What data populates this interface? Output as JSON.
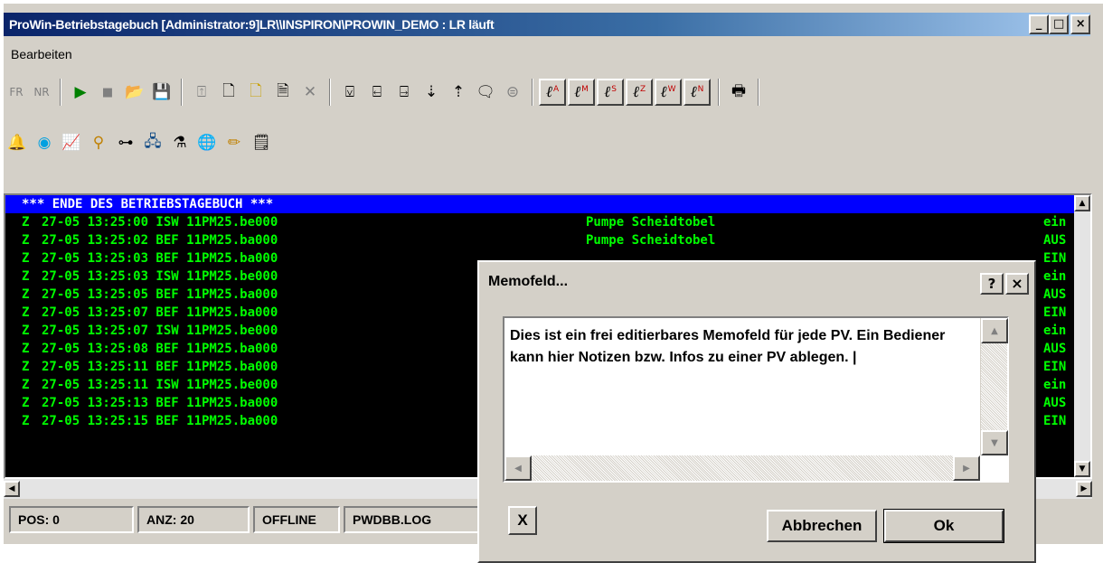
{
  "window": {
    "title": "ProWin-Betriebstagebuch [Administrator:9]LR\\\\INSPIRON\\PROWIN_DEMO : LR läuft",
    "controls": [
      "_",
      "□",
      "×"
    ]
  },
  "menu": {
    "items": [
      "Bearbeiten"
    ]
  },
  "toolbar1": {
    "fr": "FR",
    "nr": "NR",
    "pens": [
      {
        "sub": "A"
      },
      {
        "sub": "M"
      },
      {
        "sub": "S"
      },
      {
        "sub": "Z"
      },
      {
        "sub": "W"
      },
      {
        "sub": "N"
      }
    ],
    "pen_glyph": "ℓ"
  },
  "log": {
    "header": "*** ENDE DES BETRIEBSTAGEBUCH ***",
    "rows": [
      {
        "flag": "Z",
        "entry": "27-05 13:25:00 ISW 11PM25.be000",
        "name": "Pumpe Scheidtobel",
        "state": "ein"
      },
      {
        "flag": "Z",
        "entry": "27-05 13:25:02 BEF 11PM25.ba000",
        "name": "Pumpe Scheidtobel",
        "state": "AUS"
      },
      {
        "flag": "Z",
        "entry": "27-05 13:25:03 BEF 11PM25.ba000",
        "name": "",
        "state": "EIN"
      },
      {
        "flag": "Z",
        "entry": "27-05 13:25:03 ISW 11PM25.be000",
        "name": "",
        "state": "ein"
      },
      {
        "flag": "Z",
        "entry": "27-05 13:25:05 BEF 11PM25.ba000",
        "name": "",
        "state": "AUS"
      },
      {
        "flag": "Z",
        "entry": "27-05 13:25:07 BEF 11PM25.ba000",
        "name": "",
        "state": "EIN"
      },
      {
        "flag": "Z",
        "entry": "27-05 13:25:07 ISW 11PM25.be000",
        "name": "",
        "state": "ein"
      },
      {
        "flag": "Z",
        "entry": "27-05 13:25:08 BEF 11PM25.ba000",
        "name": "",
        "state": "AUS"
      },
      {
        "flag": "Z",
        "entry": "27-05 13:25:11 BEF 11PM25.ba000",
        "name": "",
        "state": "EIN"
      },
      {
        "flag": "Z",
        "entry": "27-05 13:25:11 ISW 11PM25.be000",
        "name": "",
        "state": "ein"
      },
      {
        "flag": "Z",
        "entry": "27-05 13:25:13 BEF 11PM25.ba000",
        "name": "",
        "state": "AUS"
      },
      {
        "flag": "Z",
        "entry": "27-05 13:25:15 BEF 11PM25.ba000",
        "name": "",
        "state": "EIN"
      }
    ]
  },
  "status": {
    "pos": "POS: 0",
    "anz": "ANZ: 20",
    "mode": "OFFLINE",
    "file": "PWDBB.LOG"
  },
  "dialog": {
    "title": "Memofeld...",
    "help": "?",
    "close": "×",
    "memo_text": "Dies ist ein frei editierbares Memofeld für jede PV. Ein Bediener kann hier Notizen bzw. Infos zu einer PV ablegen. |",
    "clear_label": "X",
    "cancel_label": "Abbrechen",
    "ok_label": "Ok"
  },
  "colors": {
    "log_bg": "#000000",
    "log_text": "#00ff00",
    "header_bg": "#0000ff",
    "title_bar": "#0a246a"
  }
}
